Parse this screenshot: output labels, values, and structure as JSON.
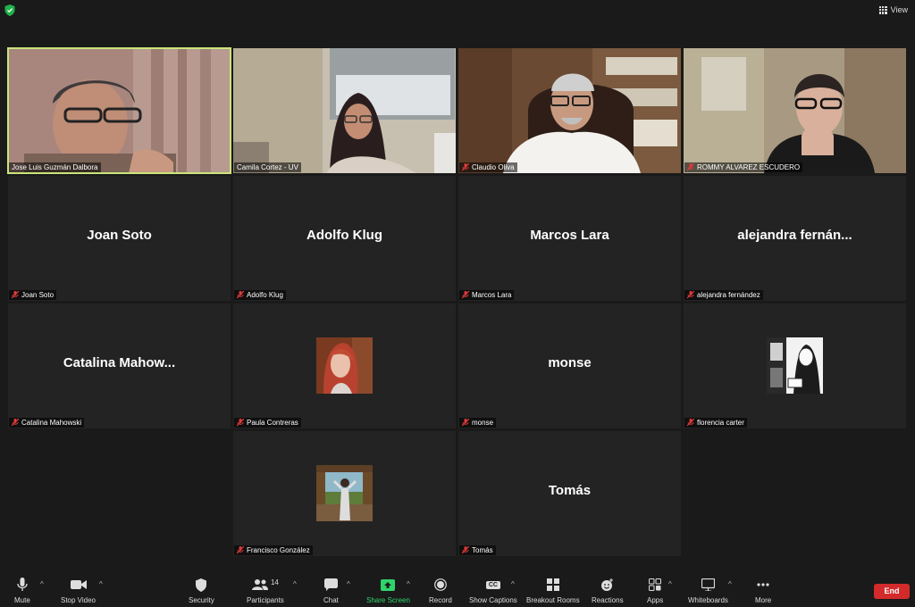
{
  "topbar": {
    "view_label": "View"
  },
  "participants": [
    {
      "name": "Jose Luis Guzmán Dalbora",
      "big_name": "",
      "muted": false,
      "video": true,
      "active": true
    },
    {
      "name": "Camila Cortez - UV",
      "big_name": "",
      "muted": false,
      "video": true,
      "active": false
    },
    {
      "name": "Claudio Oliva",
      "big_name": "",
      "muted": true,
      "video": true,
      "active": false
    },
    {
      "name": "ROMMY ALVAREZ ESCUDERO",
      "big_name": "",
      "muted": true,
      "video": true,
      "active": false
    },
    {
      "name": "Joan Soto",
      "big_name": "Joan Soto",
      "muted": true,
      "video": false,
      "active": false
    },
    {
      "name": "Adolfo Klug",
      "big_name": "Adolfo Klug",
      "muted": true,
      "video": false,
      "active": false
    },
    {
      "name": "Marcos Lara",
      "big_name": "Marcos Lara",
      "muted": true,
      "video": false,
      "active": false
    },
    {
      "name": "alejandra fernández",
      "big_name": "alejandra  fernán...",
      "muted": true,
      "video": false,
      "active": false
    },
    {
      "name": "Catalina Mahowski",
      "big_name": "Catalina  Mahow...",
      "muted": true,
      "video": false,
      "active": false
    },
    {
      "name": "Paula Contreras",
      "big_name": "",
      "muted": true,
      "video": false,
      "active": false,
      "avatar": "portrait-red"
    },
    {
      "name": "monse",
      "big_name": "monse",
      "muted": true,
      "video": false,
      "active": false
    },
    {
      "name": "florencia carter",
      "big_name": "",
      "muted": true,
      "video": false,
      "active": false,
      "avatar": "manga"
    },
    {
      "name": "Francisco González",
      "big_name": "",
      "muted": true,
      "video": false,
      "active": false,
      "avatar": "landscape"
    },
    {
      "name": "Tomás",
      "big_name": "Tomás",
      "muted": true,
      "video": false,
      "active": false
    }
  ],
  "toolbar": {
    "mute": "Mute",
    "stop_video": "Stop Video",
    "security": "Security",
    "participants": "Participants",
    "participants_count": "14",
    "chat": "Chat",
    "share_screen": "Share Screen",
    "record": "Record",
    "show_captions": "Show Captions",
    "captions_icon": "CC",
    "breakout_rooms": "Breakout Rooms",
    "reactions": "Reactions",
    "apps": "Apps",
    "whiteboards": "Whiteboards",
    "more": "More",
    "end": "End"
  },
  "colors": {
    "active_outline": "#c9e57a",
    "share_green": "#2fd36b",
    "end_red": "#d32b2b"
  }
}
